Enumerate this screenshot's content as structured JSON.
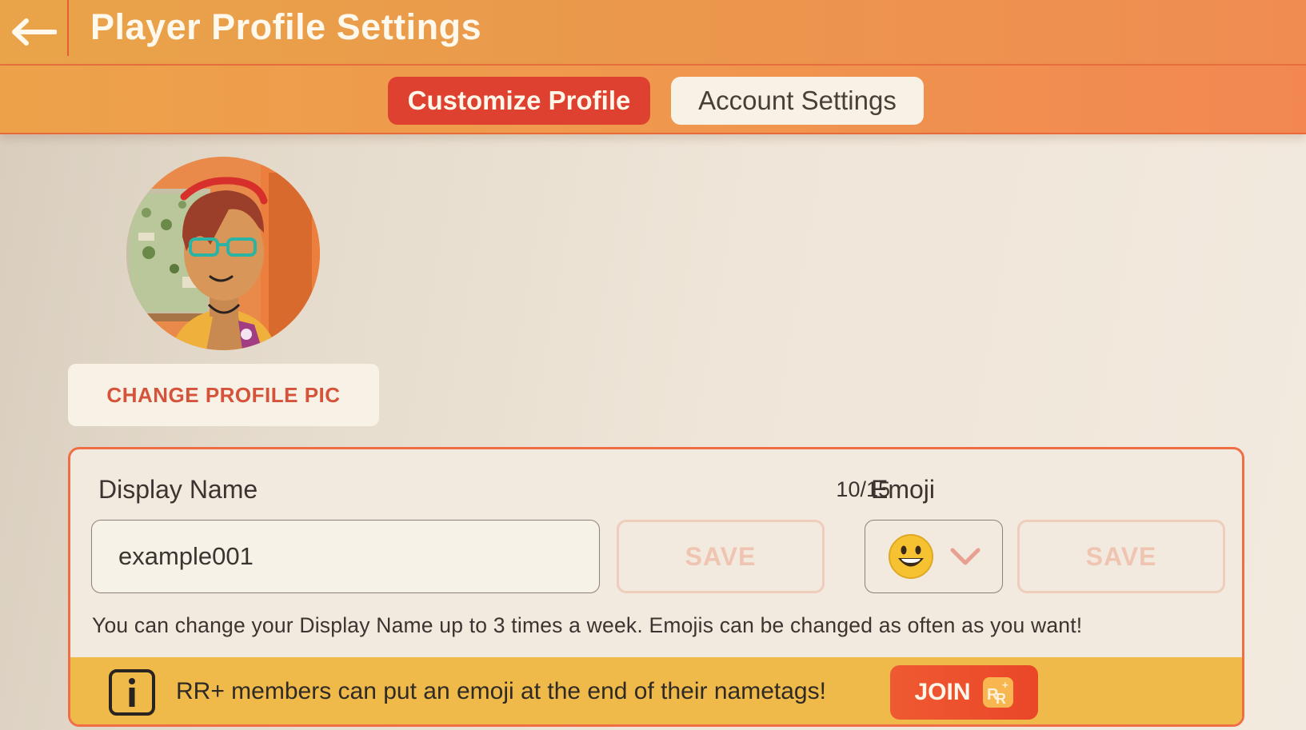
{
  "header": {
    "title": "Player Profile Settings",
    "back_icon": "arrow-left-icon"
  },
  "tabs": [
    {
      "label": "Customize Profile",
      "active": true
    },
    {
      "label": "Account Settings",
      "active": false
    }
  ],
  "profile": {
    "avatar_icon": "avatar-portrait",
    "change_pic_label": "CHANGE PROFILE PIC"
  },
  "display_name": {
    "label": "Display Name",
    "counter": "10/15",
    "value": "example001",
    "save_label": "SAVE"
  },
  "emoji": {
    "label": "Emoji",
    "selected_icon": "grinning-face-emoji",
    "chevron_icon": "chevron-down-icon",
    "save_label": "SAVE"
  },
  "help_text": "You can change your Display Name up to 3 times a week. Emojis can be changed as often as you want!",
  "promo": {
    "info_icon": "info-icon",
    "text": "RR+ members can put an emoji at the end of their nametags!",
    "join_label": "JOIN",
    "badge_icon": "rr-plus-badge-icon"
  },
  "colors": {
    "accent": "#de4130",
    "header_orange": "#ee9a4c",
    "promo_yellow": "#efba4a",
    "card_border": "#ef6e43"
  }
}
